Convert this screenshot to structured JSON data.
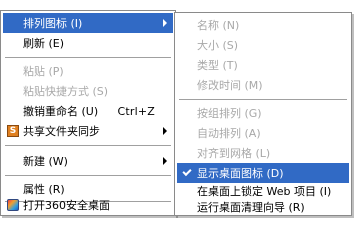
{
  "context_menu": {
    "items": [
      {
        "label": "排列图标 (I)",
        "state": "highlighted",
        "has_submenu": true
      },
      {
        "label": "刷新 (E)",
        "state": "enabled"
      },
      {
        "label": "粘贴 (P)",
        "state": "disabled"
      },
      {
        "label": "粘贴快捷方式 (S)",
        "state": "disabled"
      },
      {
        "label": "撤销重命名 (U)",
        "shortcut": "Ctrl+Z",
        "state": "enabled"
      },
      {
        "label": "共享文件夹同步",
        "state": "enabled",
        "has_submenu": true,
        "icon": "share-sync-icon"
      },
      {
        "label": "新建 (W)",
        "state": "enabled",
        "has_submenu": true
      },
      {
        "label": "属性 (R)",
        "state": "enabled"
      },
      {
        "label": "打开360安全桌面",
        "state": "enabled",
        "icon": "360-desktop-icon"
      }
    ]
  },
  "submenu": {
    "items": [
      {
        "label": "名称 (N)",
        "state": "disabled"
      },
      {
        "label": "大小 (S)",
        "state": "disabled"
      },
      {
        "label": "类型 (T)",
        "state": "disabled"
      },
      {
        "label": "修改时间 (M)",
        "state": "disabled"
      },
      {
        "label": "按组排列 (G)",
        "state": "disabled"
      },
      {
        "label": "自动排列 (A)",
        "state": "disabled"
      },
      {
        "label": "对齐到网格 (L)",
        "state": "disabled"
      },
      {
        "label": "显示桌面图标 (D)",
        "state": "highlighted",
        "checked": true
      },
      {
        "label": "在桌面上锁定 Web 项目 (I)",
        "state": "enabled"
      },
      {
        "label": "运行桌面清理向导 (R)",
        "state": "enabled"
      }
    ]
  },
  "colors": {
    "highlight": "#316ac5",
    "disabled_text": "#a8a8a8",
    "menu_border": "#8a8a8a"
  }
}
